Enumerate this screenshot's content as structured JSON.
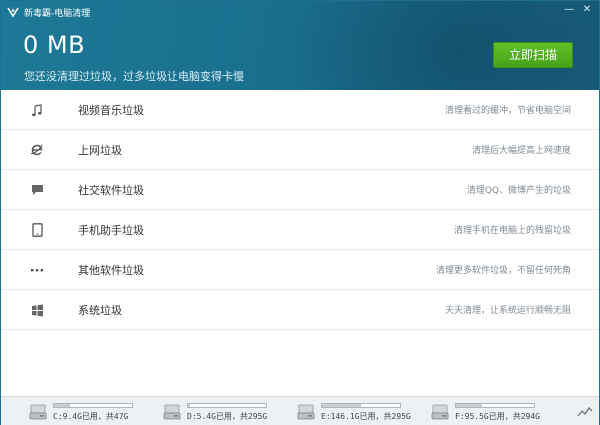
{
  "window": {
    "title": "新毒霸-电脑清理",
    "controls": {
      "minimize": "—",
      "close": "✕"
    }
  },
  "summary": {
    "size": "0 MB",
    "hint": "您还没清理过垃圾，过多垃圾让电脑变得卡慢"
  },
  "scan_button": {
    "label": "立即扫描"
  },
  "categories": [
    {
      "name": "视频音乐垃圾",
      "desc": "清理看过的缓冲，节省电脑空间",
      "icon": "music-note-icon"
    },
    {
      "name": "上网垃圾",
      "desc": "清理后大幅提高上网速度",
      "icon": "ie-browser-icon"
    },
    {
      "name": "社交软件垃圾",
      "desc": "清理QQ、微博产生的垃圾",
      "icon": "chat-bubble-icon"
    },
    {
      "name": "手机助手垃圾",
      "desc": "清理手机在电脑上的残留垃圾",
      "icon": "tablet-icon"
    },
    {
      "name": "其他软件垃圾",
      "desc": "清理更多软件垃圾，不留任何死角",
      "icon": "more-dots-icon"
    },
    {
      "name": "系统垃圾",
      "desc": "天天清理，让系统运行顺畅无阻",
      "icon": "windows-logo-icon"
    }
  ],
  "drives": [
    {
      "label": "C:9.4G已用，共47G",
      "used_fraction": 0.2
    },
    {
      "label": "D:5.4G已用，共295G",
      "used_fraction": 0.02
    },
    {
      "label": "E:146.1G已用，共295G",
      "used_fraction": 0.5
    },
    {
      "label": "F:95.5G已用，共294G",
      "used_fraction": 0.33
    }
  ],
  "colors": {
    "header": "#1a6f8e",
    "scan_button": "#4fad1f",
    "statusbar": "#eef1f4"
  }
}
